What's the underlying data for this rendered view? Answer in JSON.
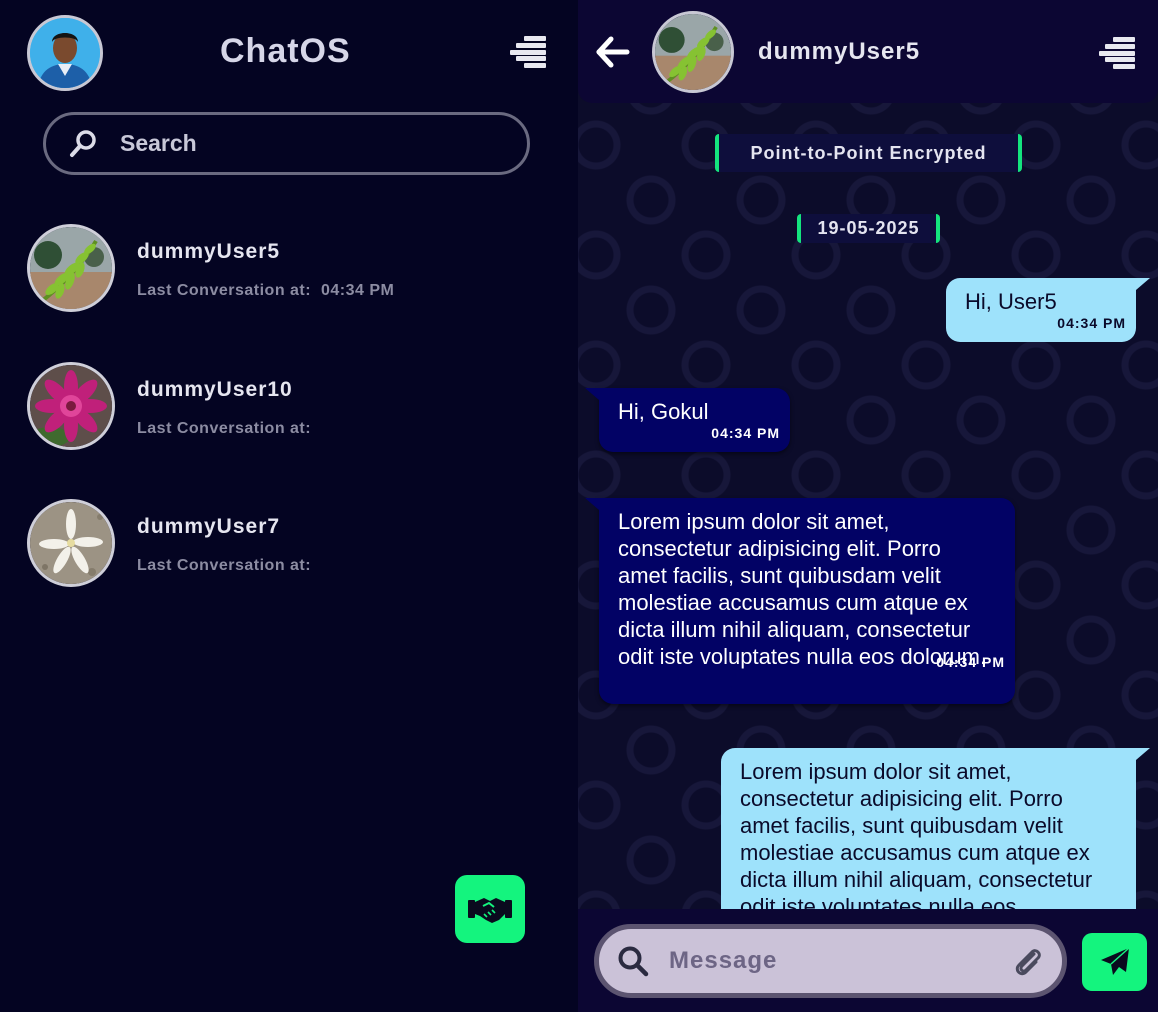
{
  "app": {
    "title": "ChatOS"
  },
  "sidebar": {
    "search_placeholder": "Search",
    "contacts": [
      {
        "name": "dummyUser5",
        "last_label": "Last Conversation at:",
        "last_time": "04:34 PM",
        "avatar": "fern-leaf-photo"
      },
      {
        "name": "dummyUser10",
        "last_label": "Last Conversation at:",
        "last_time": "",
        "avatar": "pink-flower-photo"
      },
      {
        "name": "dummyUser7",
        "last_label": "Last Conversation at:",
        "last_time": "",
        "avatar": "white-flower-photo"
      }
    ],
    "fab_icon": "handshake-icon"
  },
  "chat": {
    "peer_name": "dummyUser5",
    "encryption_notice": "Point-to-Point Encrypted",
    "date": "19-05-2025",
    "messages": [
      {
        "direction": "out",
        "text": "Hi, User5",
        "time": "04:34 PM"
      },
      {
        "direction": "in",
        "text": "Hi, Gokul",
        "time": "04:34 PM"
      },
      {
        "direction": "in",
        "text": "Lorem ipsum dolor sit amet, consectetur adipisicing elit. Porro amet facilis, sunt quibusdam velit molestiae accusamus cum atque ex dicta illum nihil aliquam, consectetur odit iste voluptates nulla eos dolorum.",
        "time": "04:34 PM"
      },
      {
        "direction": "out",
        "text": "Lorem ipsum dolor sit amet, consectetur adipisicing elit. Porro amet facilis, sunt quibusdam velit molestiae accusamus cum atque ex dicta illum nihil aliquam, consectetur odit iste voluptates nulla eos",
        "time": ""
      }
    ],
    "composer": {
      "placeholder": "Message"
    }
  },
  "colors": {
    "accent": "#14f47e",
    "outgoing_bubble": "#9ee2fb",
    "incoming_bubble": "#020265",
    "background": "#040422"
  }
}
